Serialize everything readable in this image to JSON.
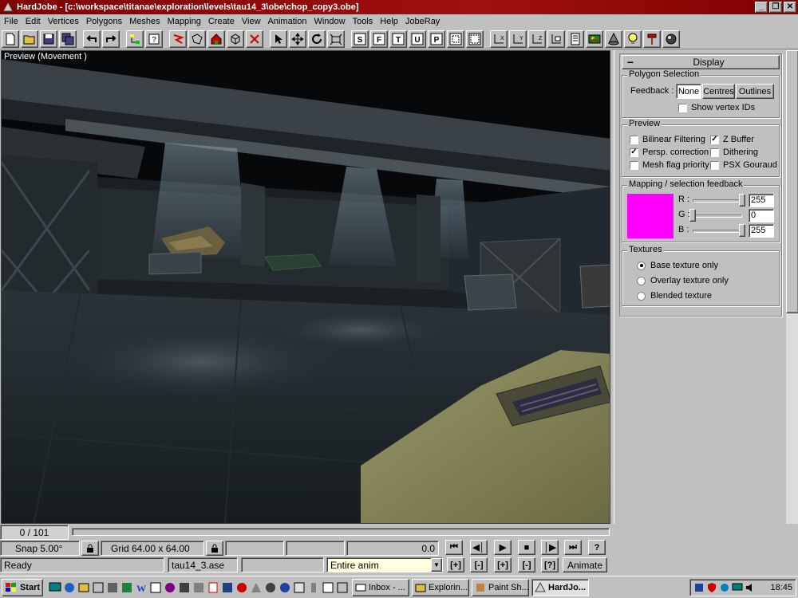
{
  "window": {
    "title": "HardJobe - [c:\\workspace\\titanae\\exploration\\levels\\tau14_3\\obe\\chop_copy3.obe]",
    "minimize_glyph": "_",
    "restore_glyph": "❐",
    "close_glyph": "✕"
  },
  "menu": [
    "File",
    "Edit",
    "Vertices",
    "Polygons",
    "Meshes",
    "Mapping",
    "Create",
    "View",
    "Animation",
    "Window",
    "Tools",
    "Help",
    "JobeRay"
  ],
  "preview": {
    "label": "Preview (Movement )"
  },
  "panel": {
    "header": {
      "collapse_glyph": "−",
      "title": "Display"
    },
    "polygon_selection": {
      "title": "Polygon Selection",
      "feedback_label": "Feedback :",
      "buttons": [
        "None",
        "Centres",
        "Outlines"
      ],
      "show_vertex_ids": {
        "label": "Show vertex IDs",
        "checked": false
      }
    },
    "preview": {
      "title": "Preview",
      "options": [
        {
          "label": "Bilinear Filtering",
          "checked": false
        },
        {
          "label": "Z Buffer",
          "checked": true
        },
        {
          "label": "Persp. correction",
          "checked": true
        },
        {
          "label": "Dithering",
          "checked": false
        },
        {
          "label": "Mesh flag priority",
          "checked": false
        },
        {
          "label": "PSX Gouraud",
          "checked": false
        }
      ]
    },
    "mapping": {
      "title": "Mapping / selection feedback",
      "color": "#ff00ff",
      "channels": [
        {
          "label": "R :",
          "value": "255",
          "level": 1.0
        },
        {
          "label": "G :",
          "value": "0",
          "level": 0.0
        },
        {
          "label": "B :",
          "value": "255",
          "level": 1.0
        }
      ]
    },
    "textures": {
      "title": "Textures",
      "options": [
        {
          "label": "Base texture only",
          "selected": true
        },
        {
          "label": "Overlay texture only",
          "selected": false
        },
        {
          "label": "Blended texture",
          "selected": false
        }
      ]
    }
  },
  "status": {
    "frame_counter": "0 / 101",
    "snap": "Snap 5.00°",
    "grid": "Grid 64.00 x 64.00",
    "time": "0.0",
    "ready": "Ready",
    "file": "tau14_3.ase",
    "anim_select": "Entire anim",
    "animate_button": "Animate",
    "help_glyph": "?",
    "transport": [
      "⏮",
      "◀│",
      "▶",
      "■",
      "│▶",
      "⏭"
    ],
    "keys": [
      "[+]",
      "[-]",
      "[+]",
      "[-]",
      "[?]"
    ]
  },
  "taskbar": {
    "start": "Start",
    "tasks": [
      {
        "label": "Inbox - ...",
        "active": false
      },
      {
        "label": "Explorin...",
        "active": false
      },
      {
        "label": "Paint Sh...",
        "active": false
      },
      {
        "label": "HardJo...",
        "active": true
      }
    ],
    "clock": "18:45"
  },
  "colors": {
    "title_bar": "#800000",
    "face": "#c0c0c0",
    "feedback": "#ff00ff"
  }
}
